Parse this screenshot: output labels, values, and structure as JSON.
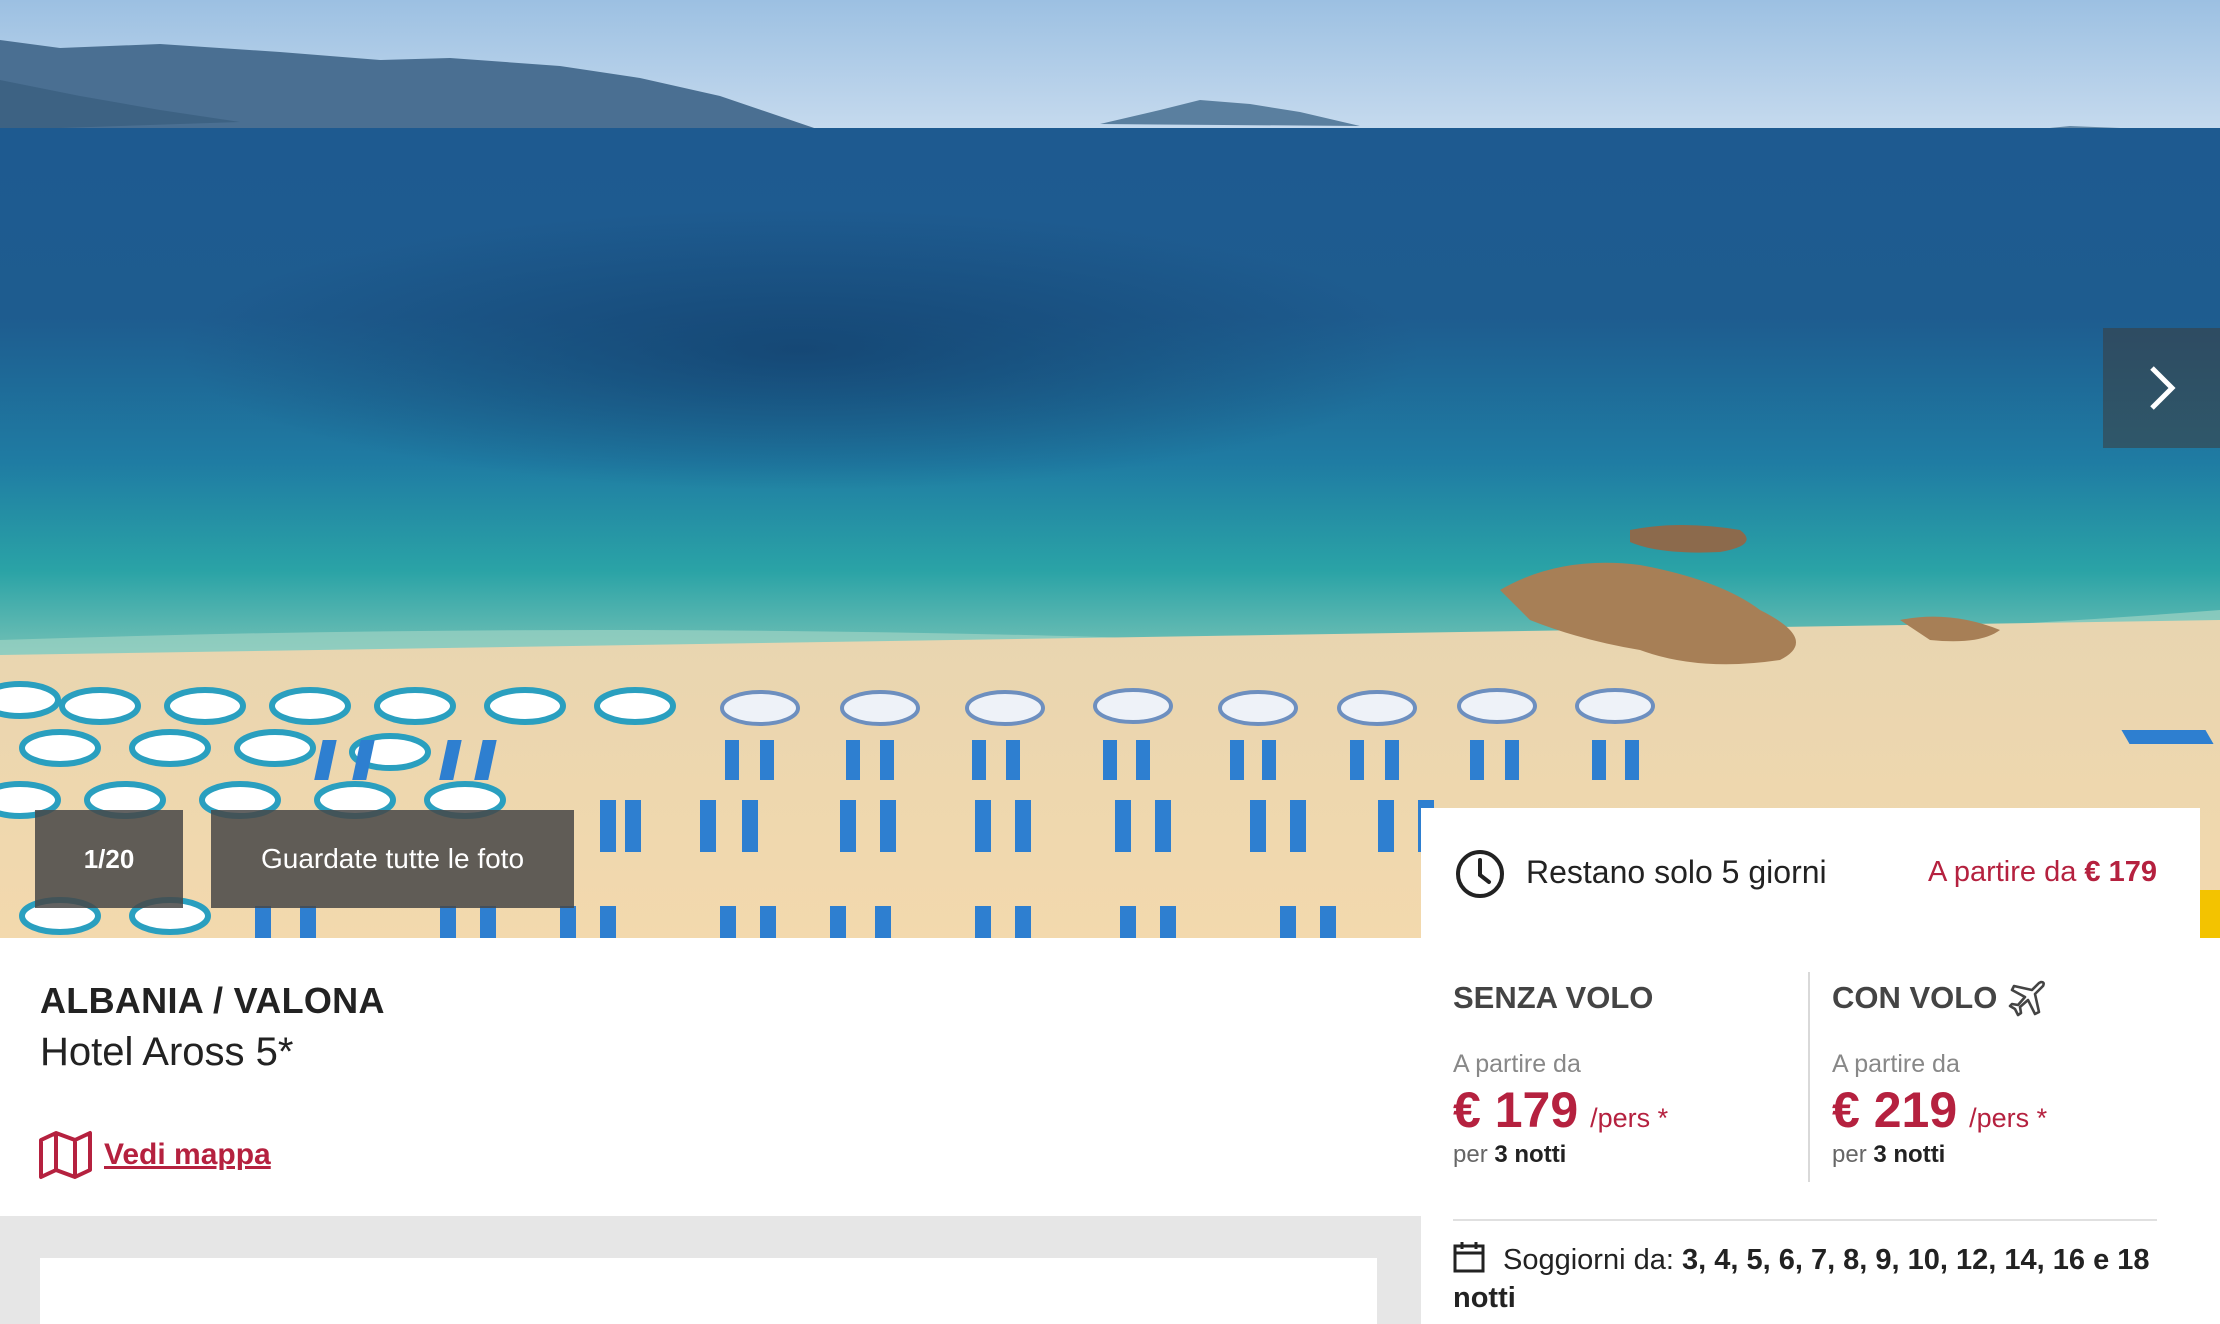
{
  "gallery": {
    "counter": "1/20",
    "all_photos_label": "Guardate tutte le foto"
  },
  "hotel": {
    "location": "ALBANIA / VALONA",
    "name": "Hotel Aross 5*",
    "map_link": "Vedi mappa"
  },
  "offer": {
    "urgency": "Restano solo 5 giorni",
    "from_prefix": "A partire da",
    "from_price": "€ 179",
    "without_flight": {
      "title": "SENZA VOLO",
      "subtitle": "A partire da",
      "price": "€ 179",
      "per": "/pers *",
      "nights_prefix": "per",
      "nights": "3 notti"
    },
    "with_flight": {
      "title": "CON VOLO",
      "subtitle": "A partire da",
      "price": "€ 219",
      "per": "/pers *",
      "nights_prefix": "per",
      "nights": "3 notti"
    },
    "stays_label": "Soggiorni da:",
    "stays_values": "3, 4, 5, 6, 7, 8, 9, 10, 12, 14, 16 e 18 notti"
  },
  "colors": {
    "accent": "#b5213f",
    "sea": "#1f7fa8",
    "sand": "#f0d7ad"
  },
  "icons": [
    "chevron-right-icon",
    "clock-icon",
    "plane-icon",
    "map-icon",
    "calendar-icon"
  ]
}
